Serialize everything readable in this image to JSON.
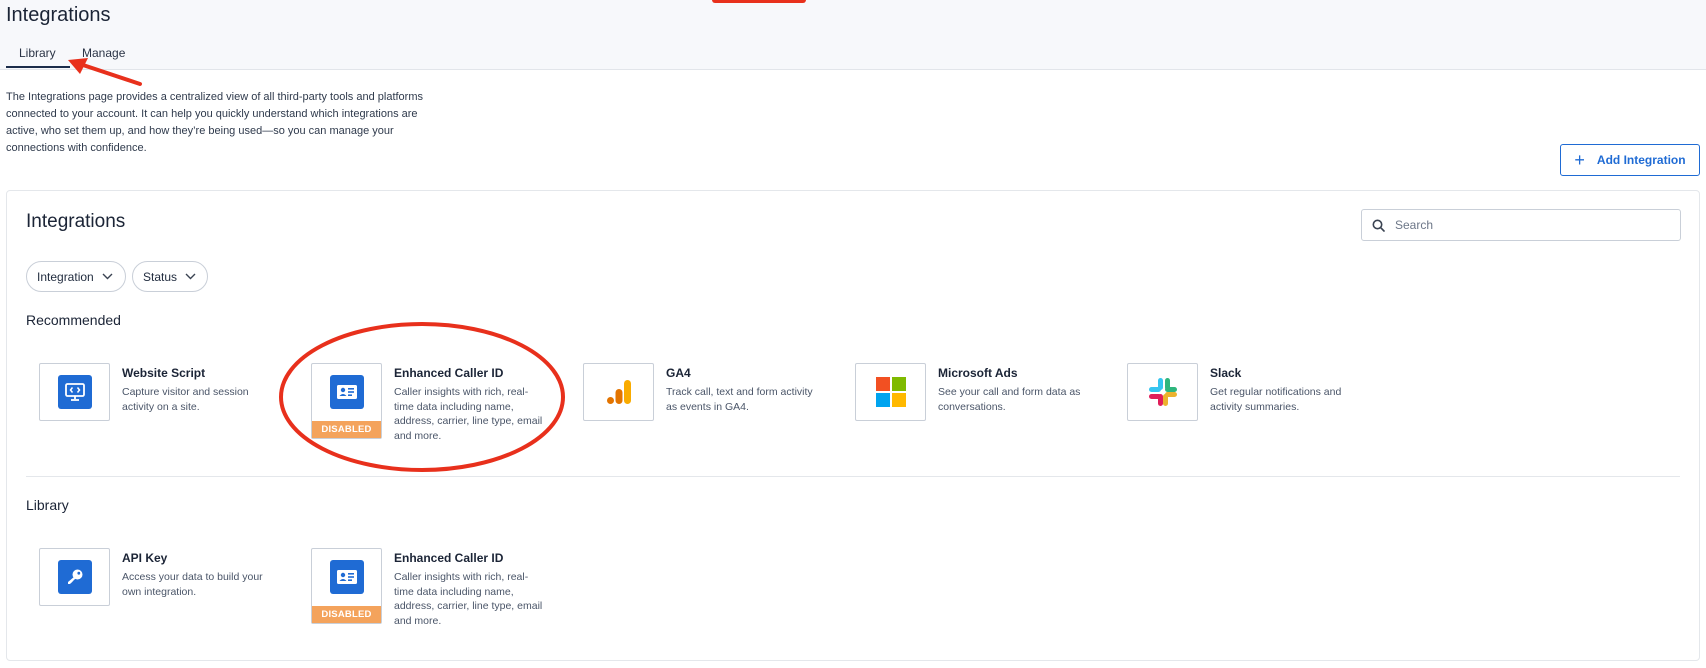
{
  "page": {
    "title": "Integrations",
    "tabs": [
      {
        "label": "Library",
        "active": true
      },
      {
        "label": "Manage",
        "active": false
      }
    ],
    "description": "The Integrations page provides a centralized view of all third-party tools and platforms connected to your account. It can help you quickly understand which integrations are active, who set them up, and how they’re being used—so you can manage your connections with confidence.",
    "add_button": {
      "label": "Add Integration",
      "icon": "plus-icon"
    }
  },
  "panel": {
    "title": "Integrations",
    "search": {
      "placeholder": "Search",
      "value": "",
      "icon": "search-icon"
    },
    "filters": [
      {
        "label": "Integration",
        "icon": "chevron-down-icon"
      },
      {
        "label": "Status",
        "icon": "chevron-down-icon"
      }
    ],
    "sections": [
      {
        "title": "Recommended",
        "cards": [
          {
            "name": "Website Script",
            "description": "Capture visitor and session activity on a site.",
            "icon": "code-monitor-icon",
            "badge": ""
          },
          {
            "name": "Enhanced Caller ID",
            "description": "Caller insights with rich, real-time data including name, address, carrier, line type, email and more.",
            "icon": "id-card-icon",
            "badge": "DISABLED"
          },
          {
            "name": "GA4",
            "description": "Track call, text and form activity as events in GA4.",
            "icon": "google-analytics-icon",
            "badge": ""
          },
          {
            "name": "Microsoft Ads",
            "description": "See your call and form data as conversations.",
            "icon": "microsoft-logo-icon",
            "badge": ""
          },
          {
            "name": "Slack",
            "description": "Get regular notifications and activity summaries.",
            "icon": "slack-logo-icon",
            "badge": ""
          }
        ]
      },
      {
        "title": "Library",
        "cards": [
          {
            "name": "API Key",
            "description": "Access your data to build your own integration.",
            "icon": "key-icon",
            "badge": ""
          },
          {
            "name": "Enhanced Caller ID",
            "description": "Caller insights with rich, real-time data including name, address, carrier, line type, email and more.",
            "icon": "id-card-icon",
            "badge": "DISABLED"
          }
        ]
      }
    ]
  },
  "colors": {
    "accent": "#1f6bd4",
    "badge_disabled": "#f4a35c",
    "annotation_red": "#e8301c"
  }
}
